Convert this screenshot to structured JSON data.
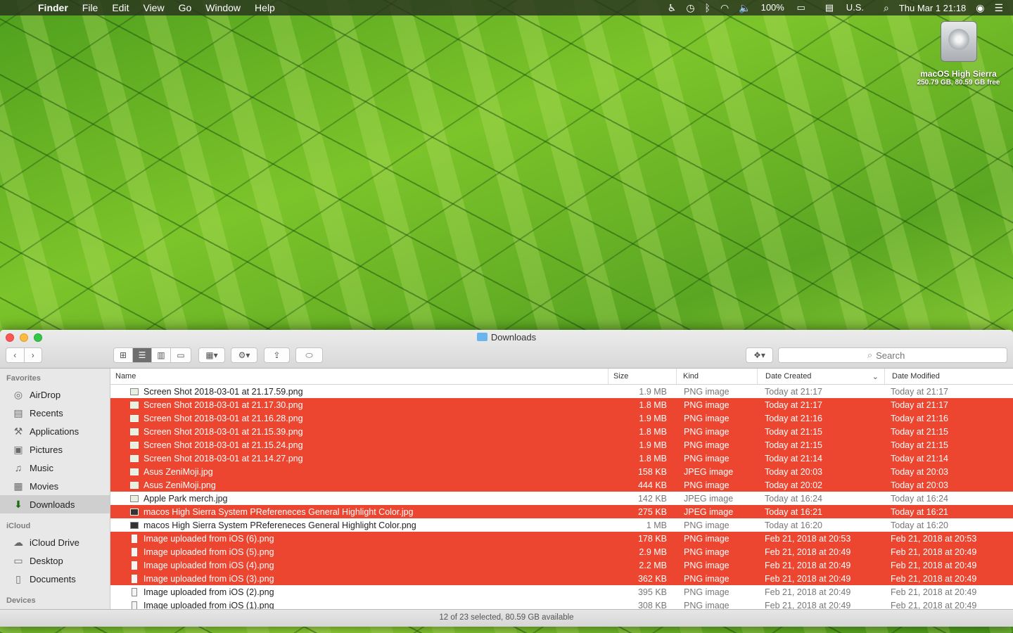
{
  "menubar": {
    "app_name": "Finder",
    "menus": [
      "File",
      "Edit",
      "View",
      "Go",
      "Window",
      "Help"
    ],
    "battery": "100%",
    "input_source": "U.S.",
    "clock": "Thu Mar 1  21:18"
  },
  "desktop": {
    "disk_name": "macOS High Sierra",
    "disk_info": "250.79 GB, 80.59 GB free"
  },
  "window": {
    "title": "Downloads",
    "search_placeholder": "Search",
    "status": "12 of 23 selected, 80.59 GB available"
  },
  "sidebar": {
    "sections": [
      {
        "header": "Favorites",
        "items": [
          {
            "label": "AirDrop",
            "icon": "airdrop-icon"
          },
          {
            "label": "Recents",
            "icon": "recents-icon"
          },
          {
            "label": "Applications",
            "icon": "applications-icon"
          },
          {
            "label": "Pictures",
            "icon": "pictures-icon"
          },
          {
            "label": "Music",
            "icon": "music-icon"
          },
          {
            "label": "Movies",
            "icon": "movies-icon"
          },
          {
            "label": "Downloads",
            "icon": "downloads-icon",
            "selected": true
          }
        ]
      },
      {
        "header": "iCloud",
        "items": [
          {
            "label": "iCloud Drive",
            "icon": "icloud-icon"
          },
          {
            "label": "Desktop",
            "icon": "desktop-icon"
          },
          {
            "label": "Documents",
            "icon": "documents-icon"
          }
        ]
      },
      {
        "header": "Devices",
        "items": []
      }
    ]
  },
  "columns": {
    "name": "Name",
    "size": "Size",
    "kind": "Kind",
    "created": "Date Created",
    "modified": "Date Modified"
  },
  "files": [
    {
      "name": "Screen Shot 2018-03-01 at 21.17.59.png",
      "size": "1.9 MB",
      "kind": "PNG image",
      "created": "Today at 21:17",
      "modified": "Today at 21:17",
      "selected": false
    },
    {
      "name": "Screen Shot 2018-03-01 at 21.17.30.png",
      "size": "1.8 MB",
      "kind": "PNG image",
      "created": "Today at 21:17",
      "modified": "Today at 21:17",
      "selected": true
    },
    {
      "name": "Screen Shot 2018-03-01 at 21.16.28.png",
      "size": "1.9 MB",
      "kind": "PNG image",
      "created": "Today at 21:16",
      "modified": "Today at 21:16",
      "selected": true
    },
    {
      "name": "Screen Shot 2018-03-01 at 21.15.39.png",
      "size": "1.8 MB",
      "kind": "PNG image",
      "created": "Today at 21:15",
      "modified": "Today at 21:15",
      "selected": true
    },
    {
      "name": "Screen Shot 2018-03-01 at 21.15.24.png",
      "size": "1.9 MB",
      "kind": "PNG image",
      "created": "Today at 21:15",
      "modified": "Today at 21:15",
      "selected": true
    },
    {
      "name": "Screen Shot 2018-03-01 at 21.14.27.png",
      "size": "1.8 MB",
      "kind": "PNG image",
      "created": "Today at 21:14",
      "modified": "Today at 21:14",
      "selected": true
    },
    {
      "name": "Asus ZeniMoji.jpg",
      "size": "158 KB",
      "kind": "JPEG image",
      "created": "Today at 20:03",
      "modified": "Today at 20:03",
      "selected": true
    },
    {
      "name": "Asus ZeniMoji.png",
      "size": "444 KB",
      "kind": "PNG image",
      "created": "Today at 20:02",
      "modified": "Today at 20:03",
      "selected": true
    },
    {
      "name": "Apple Park merch.jpg",
      "size": "142 KB",
      "kind": "JPEG image",
      "created": "Today at 16:24",
      "modified": "Today at 16:24",
      "selected": false
    },
    {
      "name": "macos High Sierra System PRefereneces General Highlight Color.jpg",
      "size": "275 KB",
      "kind": "JPEG image",
      "created": "Today at 16:21",
      "modified": "Today at 16:21",
      "selected": true
    },
    {
      "name": "macos High Sierra System PRefereneces General Highlight Color.png",
      "size": "1 MB",
      "kind": "PNG image",
      "created": "Today at 16:20",
      "modified": "Today at 16:20",
      "selected": false
    },
    {
      "name": "Image uploaded from iOS (6).png",
      "size": "178 KB",
      "kind": "PNG image",
      "created": "Feb 21, 2018 at 20:53",
      "modified": "Feb 21, 2018 at 20:53",
      "selected": true
    },
    {
      "name": "Image uploaded from iOS (5).png",
      "size": "2.9 MB",
      "kind": "PNG image",
      "created": "Feb 21, 2018 at 20:49",
      "modified": "Feb 21, 2018 at 20:49",
      "selected": true
    },
    {
      "name": "Image uploaded from iOS (4).png",
      "size": "2.2 MB",
      "kind": "PNG image",
      "created": "Feb 21, 2018 at 20:49",
      "modified": "Feb 21, 2018 at 20:49",
      "selected": true
    },
    {
      "name": "Image uploaded from iOS (3).png",
      "size": "362 KB",
      "kind": "PNG image",
      "created": "Feb 21, 2018 at 20:49",
      "modified": "Feb 21, 2018 at 20:49",
      "selected": true
    },
    {
      "name": "Image uploaded from iOS (2).png",
      "size": "395 KB",
      "kind": "PNG image",
      "created": "Feb 21, 2018 at 20:49",
      "modified": "Feb 21, 2018 at 20:49",
      "selected": false
    },
    {
      "name": "Image uploaded from iOS (1).png",
      "size": "308 KB",
      "kind": "PNG image",
      "created": "Feb 21, 2018 at 20:49",
      "modified": "Feb 21, 2018 at 20:49",
      "selected": false
    }
  ],
  "colors": {
    "selection": "#ec4530"
  }
}
